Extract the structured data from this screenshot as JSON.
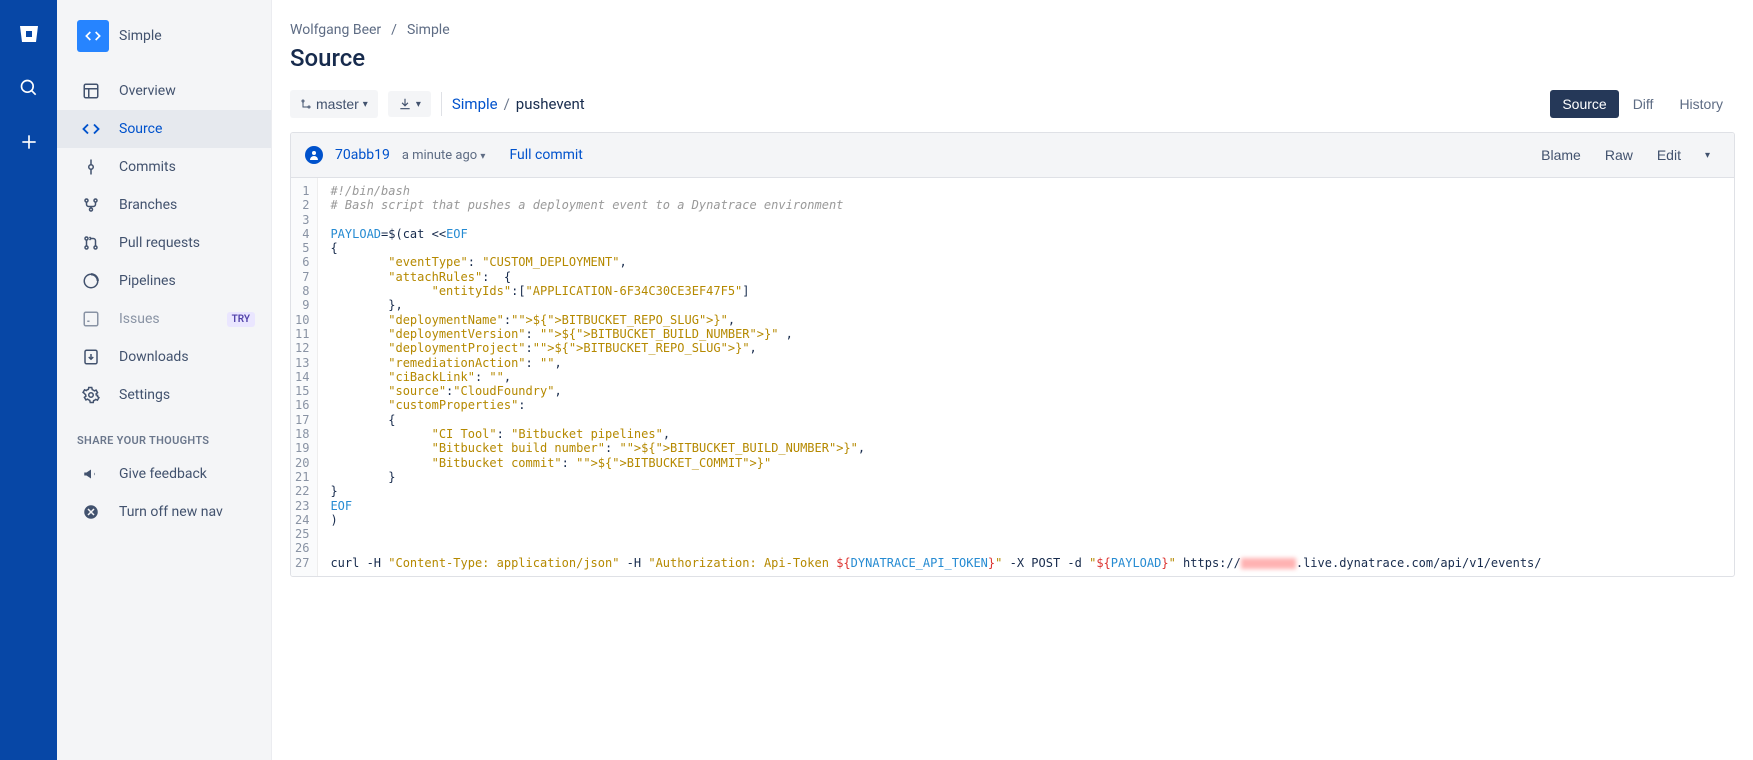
{
  "repo": {
    "name": "Simple"
  },
  "breadcrumb": {
    "owner": "Wolfgang Beer",
    "repo": "Simple"
  },
  "page_title": "Source",
  "branch_selector": "master",
  "path": {
    "repo_link": "Simple",
    "file": "pushevent"
  },
  "view_tabs": {
    "source": "Source",
    "diff": "Diff",
    "history": "History"
  },
  "commit": {
    "hash": "70abb19",
    "time": "a minute ago",
    "full": "Full commit"
  },
  "file_actions": {
    "blame": "Blame",
    "raw": "Raw",
    "edit": "Edit"
  },
  "sidebar": {
    "items": [
      {
        "label": "Overview"
      },
      {
        "label": "Source"
      },
      {
        "label": "Commits"
      },
      {
        "label": "Branches"
      },
      {
        "label": "Pull requests"
      },
      {
        "label": "Pipelines"
      },
      {
        "label": "Issues",
        "badge": "TRY"
      },
      {
        "label": "Downloads"
      },
      {
        "label": "Settings"
      }
    ],
    "section": "SHARE YOUR THOUGHTS",
    "feedback": "Give feedback",
    "turnoff": "Turn off new nav"
  },
  "code_lines": [
    "#!/bin/bash",
    "# Bash script that pushes a deployment event to a Dynatrace environment",
    "",
    "PAYLOAD=$(cat <<EOF",
    "{",
    "        \"eventType\": \"CUSTOM_DEPLOYMENT\",",
    "        \"attachRules\":  {",
    "              \"entityIds\":[\"APPLICATION-6F34C30CE3EF47F5\"]",
    "        },",
    "        \"deploymentName\":\"${BITBUCKET_REPO_SLUG}\",",
    "        \"deploymentVersion\": \"${BITBUCKET_BUILD_NUMBER}\" ,",
    "        \"deploymentProject\":\"${BITBUCKET_REPO_SLUG}\",",
    "        \"remediationAction\": \"\",",
    "        \"ciBackLink\": \"\",",
    "        \"source\":\"CloudFoundry\",",
    "        \"customProperties\":",
    "        {",
    "              \"CI Tool\": \"Bitbucket pipelines\",",
    "              \"Bitbucket build number\": \"${BITBUCKET_BUILD_NUMBER}\",",
    "              \"Bitbucket commit\": \"${BITBUCKET_COMMIT}\"",
    "        }",
    "}",
    "EOF",
    ")",
    "",
    "",
    "curl -H \"Content-Type: application/json\" -H \"Authorization: Api-Token ${DYNATRACE_API_TOKEN}\" -X POST -d \"${PAYLOAD}\" https://________.live.dynatrace.com/api/v1/events/"
  ]
}
